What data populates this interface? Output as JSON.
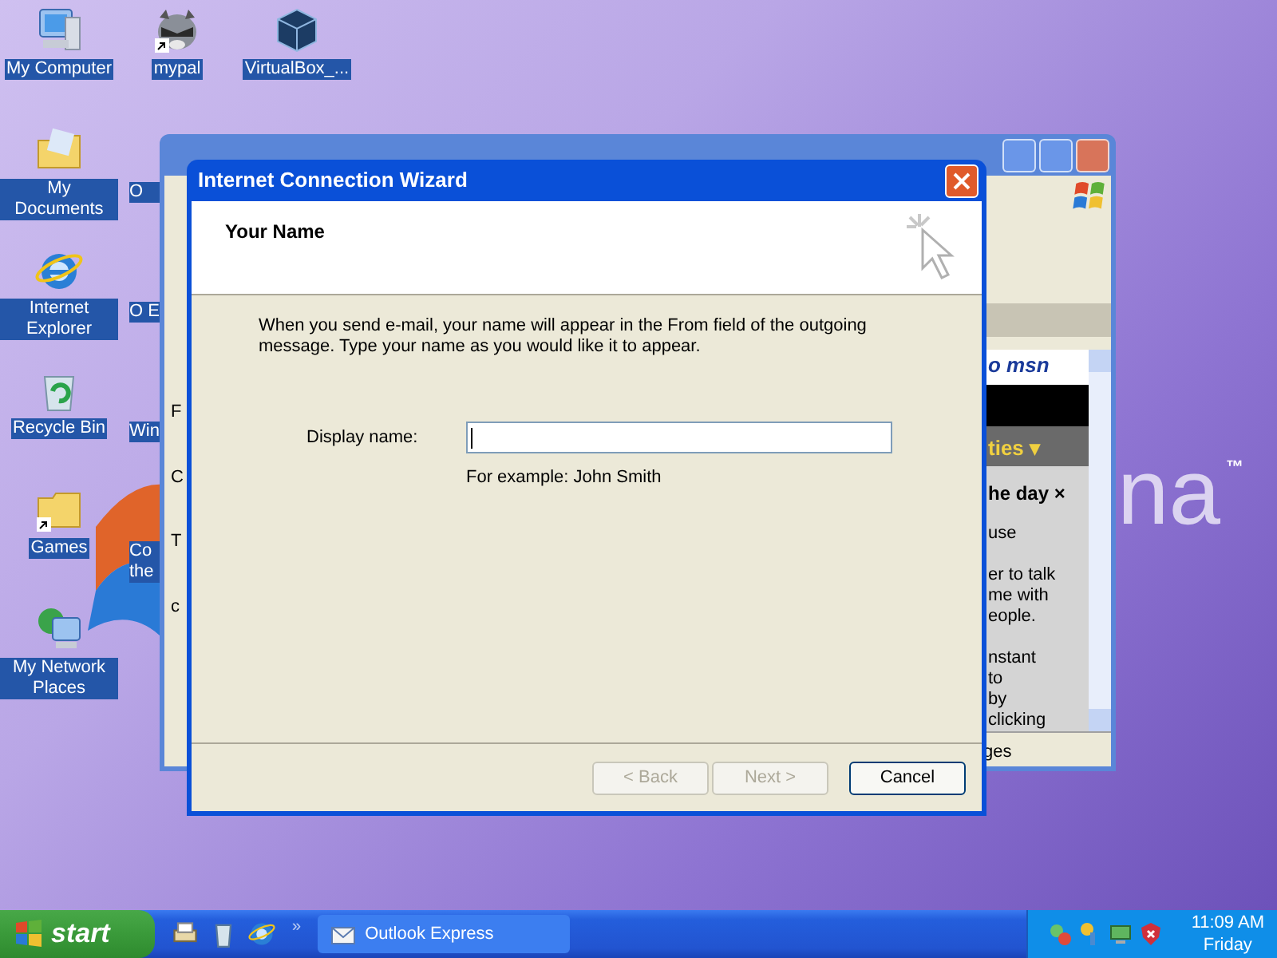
{
  "desktop": {
    "wallpaper_text": "na",
    "wallpaper_mark": "™",
    "columns": [
      [
        {
          "kind": "computer",
          "label": "My Computer"
        },
        {
          "kind": "documents",
          "label": "My Documents"
        },
        {
          "kind": "ie",
          "label": "Internet Explorer"
        },
        {
          "kind": "recycle",
          "label": "Recycle Bin"
        },
        {
          "kind": "folder",
          "label": "Games",
          "shortcut": true
        },
        {
          "kind": "network",
          "label": "My Network Places"
        }
      ],
      [
        {
          "kind": "raccoon",
          "label": "mypal",
          "shortcut": true
        },
        {
          "kind": "covered",
          "label": "O"
        },
        {
          "kind": "covered",
          "label": "O E"
        },
        {
          "kind": "covered",
          "label": "Win"
        },
        {
          "kind": "covered",
          "label": "Co the"
        }
      ],
      [
        {
          "kind": "cube",
          "label": "VirtualBox_..."
        }
      ]
    ]
  },
  "background_window": {
    "left_strip": [
      "F",
      "C",
      "T",
      "c"
    ],
    "panel": {
      "logo": "o msn",
      "menu": "ties ▾",
      "heading": "he day ×",
      "paragraphs": [
        [
          "use"
        ],
        [
          "er to talk",
          "me with",
          "eople."
        ],
        [
          "nstant",
          "to",
          "by",
          "clicking"
        ]
      ]
    },
    "status": "ges"
  },
  "wizard": {
    "title": "Internet Connection Wizard",
    "heading": "Your Name",
    "intro": "When you send e-mail, your name will appear in the From field of the outgoing message. Type your name as you would like it to appear.",
    "field": {
      "label": "Display name:",
      "focused": true
    },
    "example": "For example: John Smith",
    "buttons": [
      {
        "label": "< Back",
        "disabled": true
      },
      {
        "label": "Next >",
        "disabled": true
      },
      {
        "label": "Cancel",
        "disabled": false
      }
    ]
  },
  "taskbar": {
    "start": "start",
    "quick_launch": [
      {
        "kind": "printer"
      },
      {
        "kind": "recycle"
      },
      {
        "kind": "ie"
      }
    ],
    "chevron": "»",
    "tasks": [
      {
        "label": "Outlook Express",
        "selected": false
      }
    ],
    "tray": [
      {
        "kind": "network"
      },
      {
        "kind": "key"
      },
      {
        "kind": "monitor"
      },
      {
        "kind": "shield"
      }
    ],
    "time": "11:09 AM",
    "day": "Friday"
  }
}
